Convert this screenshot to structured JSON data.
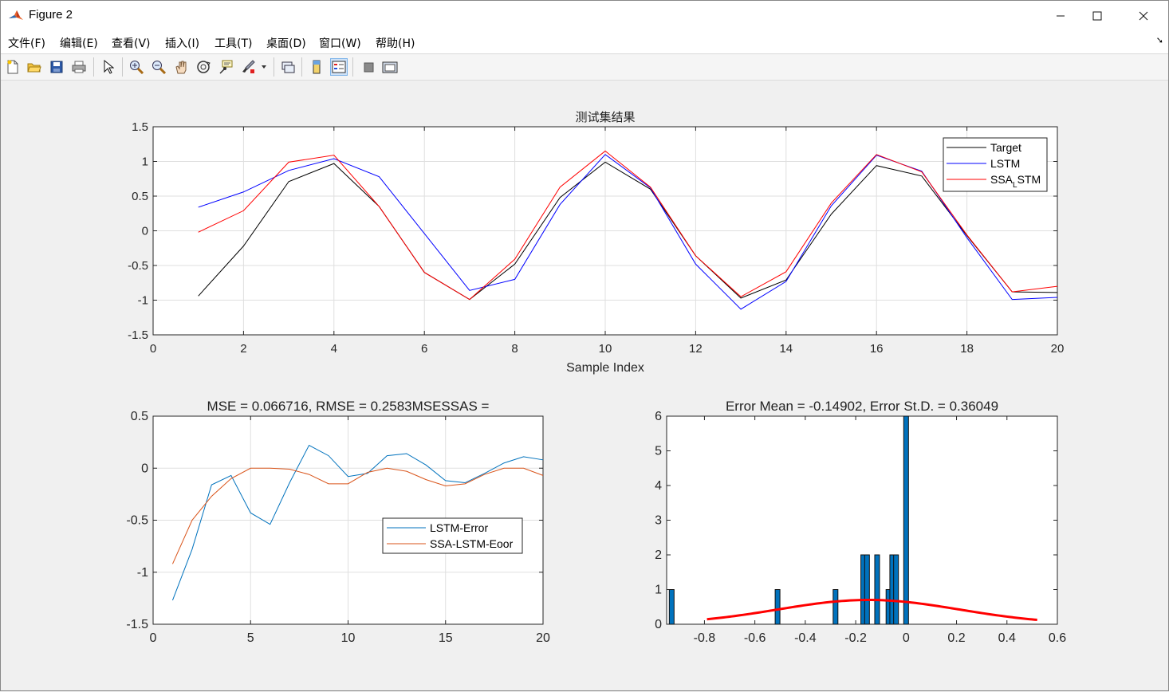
{
  "window": {
    "title": "Figure 2",
    "controls": {
      "minimize": "—",
      "maximize": "☐",
      "close": "✕"
    }
  },
  "menu": [
    "文件(F)",
    "编辑(E)",
    "查看(V)",
    "插入(I)",
    "工具(T)",
    "桌面(D)",
    "窗口(W)",
    "帮助(H)"
  ],
  "toolbar": [
    "new-figure-icon",
    "open-icon",
    "save-icon",
    "print-icon",
    "pointer-icon",
    "zoom-in-icon",
    "zoom-out-icon",
    "pan-icon",
    "rotate-icon",
    "data-cursor-icon",
    "brush-icon",
    "link-icon",
    "colorbar-icon",
    "legend-icon",
    "hide-tools-icon",
    "dock-icon"
  ],
  "colors": {
    "target": "#000000",
    "lstm": "#0000ff",
    "ssa": "#ff0000",
    "err1": "#0072bd",
    "err2": "#d95319",
    "hist": "#0072bd",
    "fit": "#ff0000"
  },
  "chart_data": [
    {
      "type": "line",
      "title": "测试集结果",
      "xlabel": "Sample Index",
      "ylabel": "",
      "xlim": [
        0,
        20
      ],
      "ylim": [
        -1.5,
        1.5
      ],
      "xticks": [
        0,
        2,
        4,
        6,
        8,
        10,
        12,
        14,
        16,
        18,
        20
      ],
      "yticks": [
        -1.5,
        -1,
        -0.5,
        0,
        0.5,
        1,
        1.5
      ],
      "grid": true,
      "legend": "top-right",
      "x": [
        1,
        2,
        3,
        4,
        5,
        6,
        7,
        8,
        9,
        10,
        11,
        12,
        13,
        14,
        15,
        16,
        17,
        18,
        19,
        20
      ],
      "series": [
        {
          "name": "Target",
          "values": [
            -0.94,
            -0.22,
            0.71,
            0.97,
            0.35,
            -0.6,
            -0.99,
            -0.48,
            0.48,
            0.99,
            0.6,
            -0.36,
            -0.97,
            -0.71,
            0.24,
            0.94,
            0.79,
            -0.07,
            -0.88,
            -0.89
          ]
        },
        {
          "name": "LSTM",
          "values": [
            0.34,
            0.56,
            0.87,
            1.04,
            0.78,
            -0.04,
            -0.86,
            -0.7,
            0.38,
            1.1,
            0.62,
            -0.48,
            -1.13,
            -0.73,
            0.36,
            1.09,
            0.86,
            -0.1,
            -0.99,
            -0.96
          ]
        },
        {
          "name": "SSA_LSTM",
          "values": [
            -0.02,
            0.29,
            0.99,
            1.09,
            0.35,
            -0.6,
            -0.99,
            -0.41,
            0.63,
            1.15,
            0.63,
            -0.36,
            -0.95,
            -0.59,
            0.4,
            1.1,
            0.85,
            -0.06,
            -0.88,
            -0.8
          ]
        }
      ]
    },
    {
      "type": "line",
      "title": "MSE = 0.066716, RMSE = 0.2583MSESSAS =",
      "xlabel": "",
      "ylabel": "",
      "xlim": [
        0,
        20
      ],
      "ylim": [
        -1.5,
        0.5
      ],
      "xticks": [
        0,
        5,
        10,
        15,
        20
      ],
      "yticks": [
        -1.5,
        -1,
        -0.5,
        0,
        0.5
      ],
      "grid": true,
      "legend": "bottom-right",
      "x": [
        1,
        2,
        3,
        4,
        5,
        6,
        7,
        8,
        9,
        10,
        11,
        12,
        13,
        14,
        15,
        16,
        17,
        18,
        19,
        20
      ],
      "series": [
        {
          "name": "LSTM-Error",
          "values": [
            -1.27,
            -0.78,
            -0.16,
            -0.07,
            -0.43,
            -0.54,
            -0.14,
            0.22,
            0.12,
            -0.08,
            -0.05,
            0.12,
            0.14,
            0.03,
            -0.12,
            -0.14,
            -0.05,
            0.05,
            0.11,
            0.08
          ]
        },
        {
          "name": "SSA-LSTM-Eoor",
          "values": [
            -0.92,
            -0.5,
            -0.27,
            -0.1,
            0.0,
            0.0,
            -0.01,
            -0.06,
            -0.15,
            -0.15,
            -0.04,
            0.0,
            -0.03,
            -0.11,
            -0.17,
            -0.15,
            -0.06,
            0.0,
            0.0,
            -0.07
          ]
        }
      ]
    },
    {
      "type": "bar",
      "title": "Error Mean = -0.14902, Error St.D. = 0.36049",
      "xlabel": "",
      "ylabel": "",
      "xlim": [
        -0.95,
        0.6
      ],
      "ylim": [
        0,
        6
      ],
      "xticks": [
        -0.8,
        -0.6,
        -0.4,
        -0.2,
        0,
        0.2,
        0.4,
        0.6
      ],
      "yticks": [
        0,
        1,
        2,
        3,
        4,
        5,
        6
      ],
      "grid": false,
      "bins": [
        {
          "x": -0.93,
          "count": 1
        },
        {
          "x": -0.51,
          "count": 1
        },
        {
          "x": -0.28,
          "count": 1
        },
        {
          "x": -0.17,
          "count": 2
        },
        {
          "x": -0.155,
          "count": 2
        },
        {
          "x": -0.115,
          "count": 2
        },
        {
          "x": -0.07,
          "count": 1
        },
        {
          "x": -0.055,
          "count": 2
        },
        {
          "x": -0.04,
          "count": 2
        },
        {
          "x": 0.0,
          "count": 6
        }
      ],
      "fit": {
        "mean": -0.14902,
        "std": 0.36049,
        "scale": 0.62,
        "xrange": [
          -0.79,
          0.52
        ]
      }
    }
  ]
}
